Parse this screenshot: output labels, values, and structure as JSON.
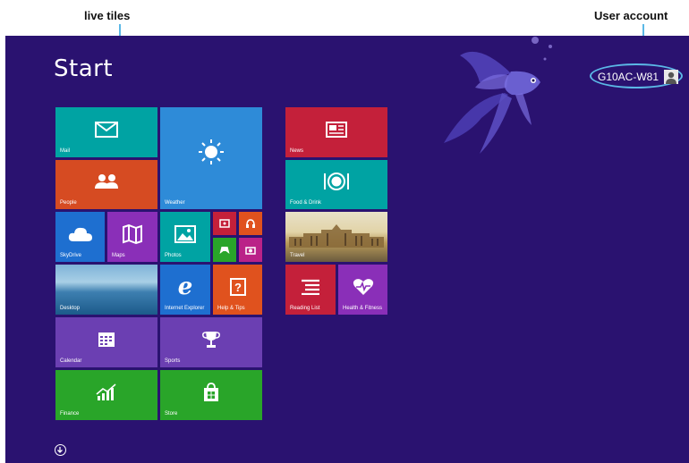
{
  "callouts": {
    "live_tiles": "live tiles",
    "user_account": "User account"
  },
  "start": {
    "title": "Start"
  },
  "user": {
    "name": "G10AC-W81",
    "icon": "user-avatar-icon"
  },
  "tiles": {
    "mail": "Mail",
    "weather": "Weather",
    "people": "People",
    "skydrive": "SkyDrive",
    "maps": "Maps",
    "photos": "Photos",
    "desktop": "Desktop",
    "internet_explorer": "Internet Explorer",
    "help_tips": "Help & Tips",
    "calendar": "Calendar",
    "sports": "Sports",
    "finance": "Finance",
    "store": "Store",
    "news": "News",
    "food_drink": "Food & Drink",
    "travel": "Travel",
    "reading_list": "Reading List",
    "health_fitness": "Health & Fitness"
  },
  "colors": {
    "background": "#2a1270",
    "teal": "#00a3a3",
    "orange": "#d64b22",
    "blue": "#2e8bd8",
    "purple": "#6b3fb2",
    "green": "#29a529",
    "crimson": "#c4203a",
    "magenta": "#ba2288",
    "callout_line": "#5bb8e6"
  }
}
